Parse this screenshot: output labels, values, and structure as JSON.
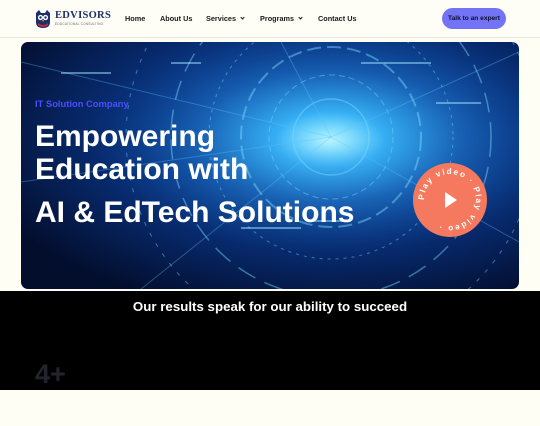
{
  "brand": {
    "name": "EDVISORS",
    "tagline": "EDUCATIONAL CONSULTING"
  },
  "nav": {
    "items": [
      {
        "label": "Home",
        "has_dropdown": false
      },
      {
        "label": "About Us",
        "has_dropdown": false
      },
      {
        "label": "Services",
        "has_dropdown": true
      },
      {
        "label": "Programs",
        "has_dropdown": true
      },
      {
        "label": "Contact Us",
        "has_dropdown": false
      }
    ],
    "cta_label": "Talk to an expert"
  },
  "hero": {
    "kicker": "IT Solution Company",
    "title_line1": "Empowering",
    "title_line2": "Education with",
    "title_line3": "AI & EdTech Solutions",
    "play_label": "Play video · Play video ·",
    "play_icon": "play-triangle-icon"
  },
  "results": {
    "title": "Our results speak for our ability to succeed",
    "stat_value": "4+"
  },
  "colors": {
    "accent": "#7373f5",
    "kicker": "#4d4dff",
    "play": "#f5795e",
    "band": "#000000",
    "page": "#fefef5"
  }
}
